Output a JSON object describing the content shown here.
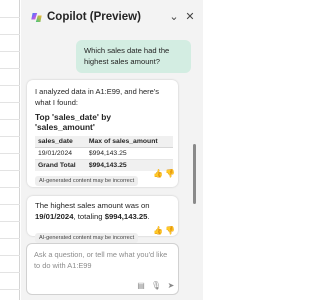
{
  "header": {
    "title": "Copilot (Preview)",
    "more_icon": "chevron-down-icon",
    "close_icon": "close-icon",
    "more_glyph": "⌄",
    "close_glyph": "✕"
  },
  "conversation": {
    "user_message": "Which sales date had the highest sales amount?",
    "response1": {
      "intro": "I analyzed data in A1:E99, and here's what I found:",
      "heading": "Top 'sales_date' by 'sales_amount'",
      "table": {
        "columns": [
          "sales_date",
          "Max of sales_amount"
        ],
        "rows": [
          [
            "19/01/2024",
            "$994,143.25"
          ]
        ],
        "total": [
          "Grand Total",
          "$994,143.25"
        ]
      },
      "disclaimer": "AI-generated content may be incorrect"
    },
    "response2": {
      "text_before": "The highest sales amount was on ",
      "date": "19/01/2024",
      "text_middle": ", totaling ",
      "amount": "$994,143.25",
      "text_after": ".",
      "disclaimer": "AI-generated content may be incorrect"
    }
  },
  "composer": {
    "placeholder": "Ask a question, or tell me what you'd like to do with A1:E99"
  },
  "icons": {
    "thumbs_up": "👍",
    "thumbs_down": "👎",
    "prompts": "▤",
    "mic": "🎙",
    "send": "➤"
  },
  "colors": {
    "user_bubble": "#d3ede2",
    "pane_bg": "#f3f3f3"
  }
}
